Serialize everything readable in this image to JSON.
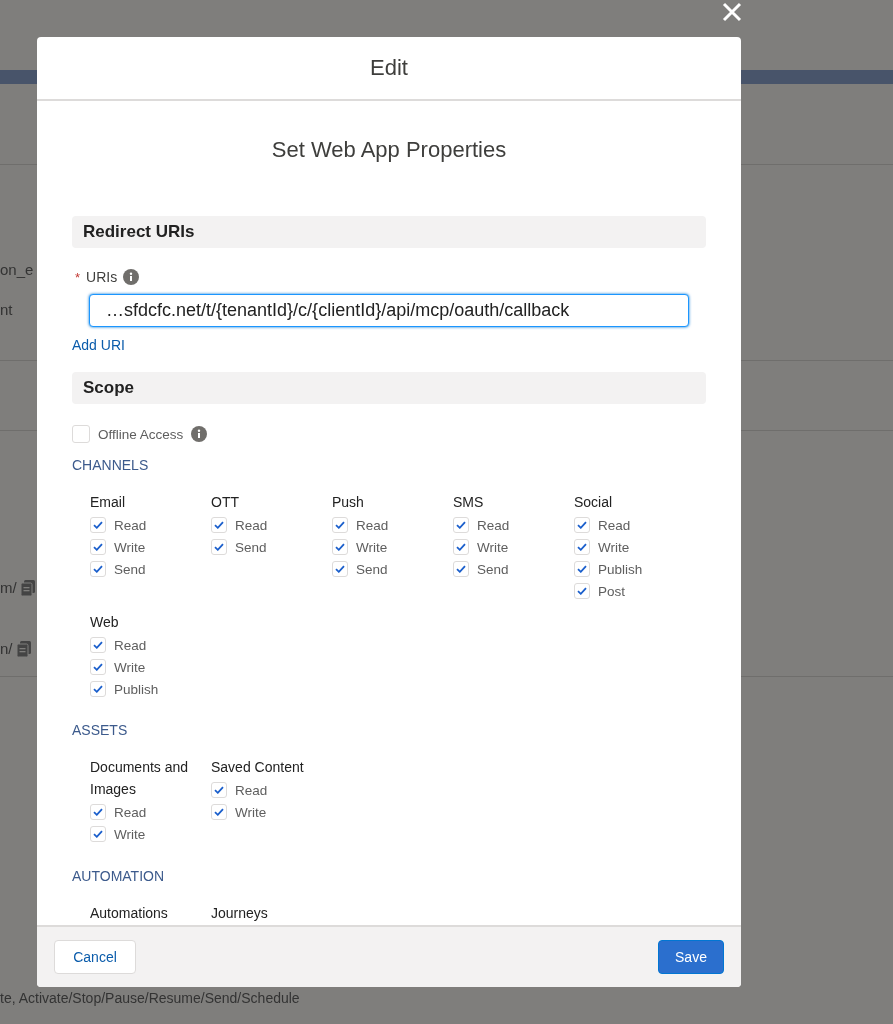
{
  "background": {
    "fragments": [
      {
        "text": "on_e",
        "kind": "text"
      },
      {
        "text": "nt",
        "kind": "text"
      },
      {
        "text": "m/",
        "kind": "copy"
      },
      {
        "text": "n/",
        "kind": "copy"
      }
    ],
    "footer_text": "te, Activate/Stop/Pause/Resume/Send/Schedule"
  },
  "modal": {
    "title": "Edit",
    "heading": "Set Web App Properties",
    "redirect": {
      "title": "Redirect URIs",
      "field": {
        "label": "URIs",
        "required_mark": "*",
        "value": "…sfdcfc.net/t/{tenantId}/c/{clientId}/api/mcp/oauth/callback"
      },
      "link": "Add URI"
    },
    "scope": {
      "title": "Scope",
      "offline": {
        "label": "Offline Access",
        "checked": false
      }
    },
    "categories": [
      {
        "title": "CHANNELS",
        "groups": [
          {
            "name": "Email",
            "permissions": [
              {
                "label": "Read",
                "checked": true
              },
              {
                "label": "Write",
                "checked": true
              },
              {
                "label": "Send",
                "checked": true
              }
            ]
          },
          {
            "name": "OTT",
            "permissions": [
              {
                "label": "Read",
                "checked": true
              },
              {
                "label": "Send",
                "checked": true
              }
            ]
          },
          {
            "name": "Push",
            "permissions": [
              {
                "label": "Read",
                "checked": true
              },
              {
                "label": "Write",
                "checked": true
              },
              {
                "label": "Send",
                "checked": true
              }
            ]
          },
          {
            "name": "SMS",
            "permissions": [
              {
                "label": "Read",
                "checked": true
              },
              {
                "label": "Write",
                "checked": true
              },
              {
                "label": "Send",
                "checked": true
              }
            ]
          },
          {
            "name": "Social",
            "permissions": [
              {
                "label": "Read",
                "checked": true
              },
              {
                "label": "Write",
                "checked": true
              },
              {
                "label": "Publish",
                "checked": true
              },
              {
                "label": "Post",
                "checked": true
              }
            ]
          },
          {
            "name": "Web",
            "permissions": [
              {
                "label": "Read",
                "checked": true
              },
              {
                "label": "Write",
                "checked": true
              },
              {
                "label": "Publish",
                "checked": true
              }
            ]
          }
        ]
      },
      {
        "title": "ASSETS",
        "groups": [
          {
            "name": "Documents and Images",
            "permissions": [
              {
                "label": "Read",
                "checked": true
              },
              {
                "label": "Write",
                "checked": true
              }
            ]
          },
          {
            "name": "Saved Content",
            "permissions": [
              {
                "label": "Read",
                "checked": true
              },
              {
                "label": "Write",
                "checked": true
              }
            ]
          }
        ]
      },
      {
        "title": "AUTOMATION",
        "groups": [
          {
            "name": "Automations"
          },
          {
            "name": "Journeys"
          }
        ]
      }
    ],
    "buttons": {
      "cancel": "Cancel",
      "save": "Save"
    }
  }
}
